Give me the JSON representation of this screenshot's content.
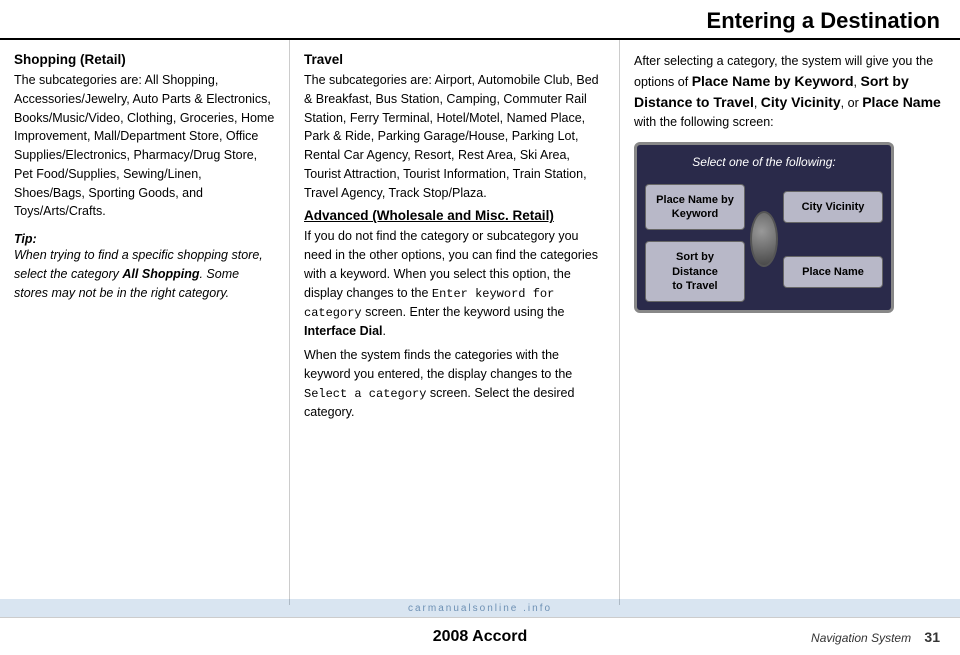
{
  "header": {
    "title": "Entering a Destination"
  },
  "footer": {
    "center_text": "2008  Accord",
    "right_label": "Navigation System",
    "page_number": "31"
  },
  "left_column": {
    "section_title": "Shopping (Retail)",
    "body_text": "The subcategories are: All Shopping, Accessories/Jewelry, Auto Parts & Electronics, Books/Music/Video, Clothing, Groceries, Home Improvement, Mall/Department Store, Office Supplies/Electronics, Pharmacy/Drug Store, Pet Food/Supplies, Sewing/Linen, Shoes/Bags, Sporting Goods, and Toys/Arts/Crafts.",
    "tip_label": "Tip:",
    "tip_text": "When trying to find a specific shopping store, select the category ",
    "tip_bold": "All Shopping",
    "tip_text2": ". Some stores may not be in the right category."
  },
  "mid_column": {
    "section_title": "Travel",
    "body_text": "The subcategories are: Airport, Automobile Club, Bed & Breakfast, Bus Station, Camping, Commuter Rail Station, Ferry Terminal, Hotel/Motel, Named Place, Park & Ride, Parking Garage/House, Parking Lot, Rental Car Agency, Resort, Rest Area, Ski Area, Tourist Attraction, Tourist Information, Train Station, Travel Agency, Track Stop/Plaza.",
    "section2_title": "Advanced (Wholesale and Misc. Retail)",
    "body2_text": "If you do not find the category or subcategory you need in the other options, you can find the categories with a keyword. When you select this option, the display changes to the ",
    "body2_mono": "Enter keyword for category",
    "body2_text2": " screen. Enter the keyword using the ",
    "body2_bold": "Interface Dial",
    "body2_text3": ".",
    "body3_text": "When the system finds the categories with the keyword you entered, the display changes to the ",
    "body3_mono": "Select a category",
    "body3_text2": " screen. Select the desired category."
  },
  "right_column": {
    "intro_text": "After selecting a category, the system will give you the options of ",
    "bold1": "Place Name by Keyword",
    "text2": ", ",
    "bold2": "Sort by Distance to Travel",
    "text3": ", ",
    "bold3": "City Vicinity",
    "text4": ", or ",
    "bold4": "Place Name",
    "text5": " with the following screen:",
    "nav_screen": {
      "title": "Select one of the following:",
      "btn1": "Place Name by\nKeyword",
      "btn2": "City Vicinity",
      "btn3": "Sort by Distance\nto Travel",
      "btn4": "Place Name"
    }
  },
  "watermark": {
    "text": "carmanualsonline .info"
  }
}
